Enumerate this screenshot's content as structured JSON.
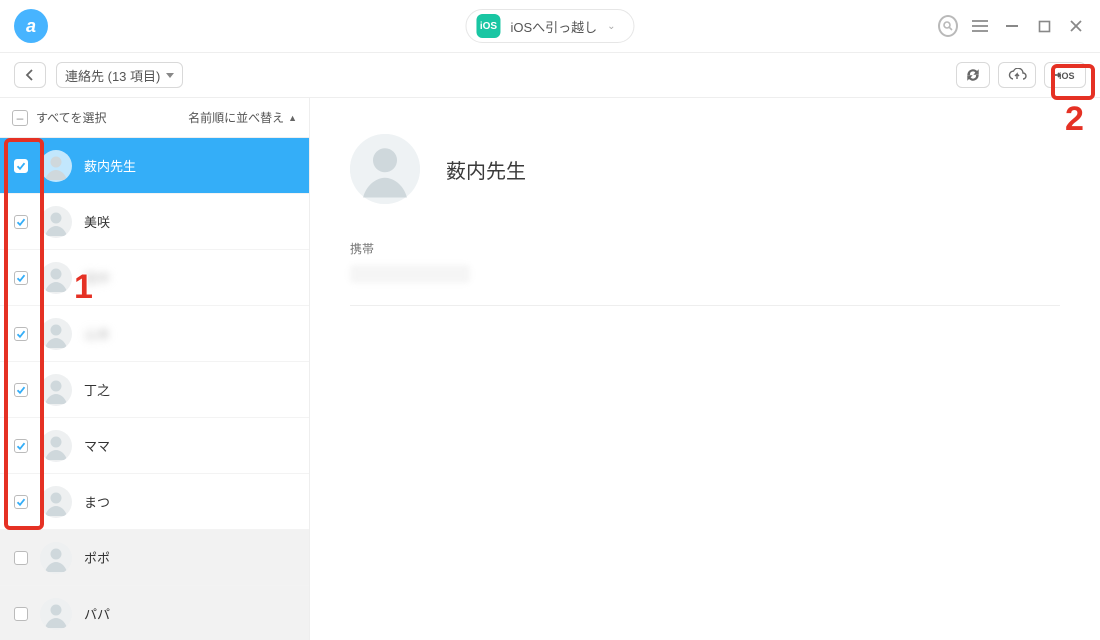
{
  "titlebar": {
    "app_glyph": "a",
    "ios_badge": "iOS",
    "mode_label": "iOSへ引っ越し"
  },
  "toolbar": {
    "back_glyph": "‹",
    "breadcrumb": "連絡先 (13 項目)"
  },
  "sidebar": {
    "select_all_glyph": "–",
    "select_all_label": "すべてを選択",
    "sort_label": "名前順に並べ替え",
    "contacts": [
      {
        "name": "薮内先生",
        "checked": true,
        "selected": true,
        "blur": false,
        "disabled": false
      },
      {
        "name": "美咲",
        "checked": true,
        "selected": false,
        "blur": false,
        "disabled": false
      },
      {
        "name": "田中",
        "checked": true,
        "selected": false,
        "blur": true,
        "disabled": false
      },
      {
        "name": "山本",
        "checked": true,
        "selected": false,
        "blur": true,
        "disabled": false
      },
      {
        "name": "丁之",
        "checked": true,
        "selected": false,
        "blur": false,
        "disabled": false
      },
      {
        "name": "ママ",
        "checked": true,
        "selected": false,
        "blur": false,
        "disabled": false
      },
      {
        "name": "まつ",
        "checked": true,
        "selected": false,
        "blur": false,
        "disabled": false
      },
      {
        "name": "ポポ",
        "checked": false,
        "selected": false,
        "blur": false,
        "disabled": true
      },
      {
        "name": "パパ",
        "checked": false,
        "selected": false,
        "blur": false,
        "disabled": true
      }
    ]
  },
  "detail": {
    "name": "薮内先生",
    "field_label": "携帯"
  },
  "annotations": {
    "one": "1",
    "two": "2"
  }
}
